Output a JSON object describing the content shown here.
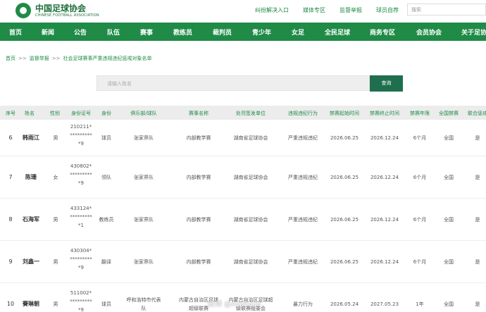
{
  "header": {
    "logo_cn": "中国足球协会",
    "logo_en": "CHINESE FOOTBALL ASSOCIATION",
    "links": [
      "纠纷解决入口",
      "媒体专区",
      "监督举报",
      "球员自荐"
    ],
    "search_placeholder": "搜索"
  },
  "nav": [
    "首页",
    "新闻",
    "公告",
    "队伍",
    "赛事",
    "教练员",
    "裁判员",
    "青少年",
    "女足",
    "全民足球",
    "商务专区",
    "会员协会",
    "关于足协"
  ],
  "breadcrumb": [
    "首页",
    "监督举报",
    "社会足球赛事严重违规违纪惩戒对象名单"
  ],
  "search": {
    "placeholder": "请输入姓名",
    "button": "查询"
  },
  "table": {
    "headers": [
      "序号",
      "姓名",
      "性别",
      "身份证号",
      "身份",
      "俱乐部/球队",
      "赛事名称",
      "处罚签发单位",
      "违规违纪行为",
      "禁赛起始时间",
      "禁赛终止时间",
      "禁赛年限",
      "全国禁赛",
      "联合惩戒"
    ],
    "rows": [
      {
        "no": "6",
        "name": "韩雨江",
        "gender": "男",
        "id": [
          "210211*",
          "*********",
          "*9"
        ],
        "role": "球员",
        "club": [
          "张家界队"
        ],
        "event": [
          "内部教学赛"
        ],
        "issuer": [
          "湖南省足球协会"
        ],
        "violation": "严重违规违纪",
        "start": "2026.06.25",
        "end": "2026.12.24",
        "years": "6个月",
        "national": "全国",
        "joint": "是"
      },
      {
        "no": "7",
        "name": "陈珊",
        "gender": "女",
        "id": [
          "430802*",
          "*********",
          "*9"
        ],
        "role": "领队",
        "club": [
          "张家界队"
        ],
        "event": [
          "内部教学赛"
        ],
        "issuer": [
          "湖南省足球协会"
        ],
        "violation": "严重违规违纪",
        "start": "2026.06.25",
        "end": "2026.12.24",
        "years": "6个月",
        "national": "全国",
        "joint": "是"
      },
      {
        "no": "8",
        "name": "石海军",
        "gender": "男",
        "id": [
          "433124*",
          "*********",
          "*1"
        ],
        "role": "教练员",
        "club": [
          "张家界队"
        ],
        "event": [
          "内部教学赛"
        ],
        "issuer": [
          "湖南省足球协会"
        ],
        "violation": "严重违规违纪",
        "start": "2026.06.25",
        "end": "2026.12.24",
        "years": "6个月",
        "national": "全国",
        "joint": "是"
      },
      {
        "no": "9",
        "name": "刘鑫一",
        "gender": "男",
        "id": [
          "430304*",
          "*********",
          "*9"
        ],
        "role": "翻译",
        "club": [
          "张家界队"
        ],
        "event": [
          "内部教学赛"
        ],
        "issuer": [
          "湖南省足球协会"
        ],
        "violation": "严重违规违纪",
        "start": "2026.06.25",
        "end": "2026.12.24",
        "years": "6个月",
        "national": "全国",
        "joint": "是"
      },
      {
        "no": "10",
        "name": "賽琳朝",
        "gender": "男",
        "id": [
          "511002*",
          "*********",
          "*9"
        ],
        "role": "球员",
        "club": [
          "呼和浩特市代表",
          "队"
        ],
        "event": [
          "内蒙古自治区足球",
          "超级联赛"
        ],
        "issuer": [
          "内蒙古自治区足球超",
          "级联赛组委会"
        ],
        "violation": "暴力行为",
        "start": "2026.05.24",
        "end": "2027.05.23",
        "years": "1年",
        "national": "全国",
        "joint": "是"
      }
    ]
  },
  "watermark": "微博 @Asakaua"
}
